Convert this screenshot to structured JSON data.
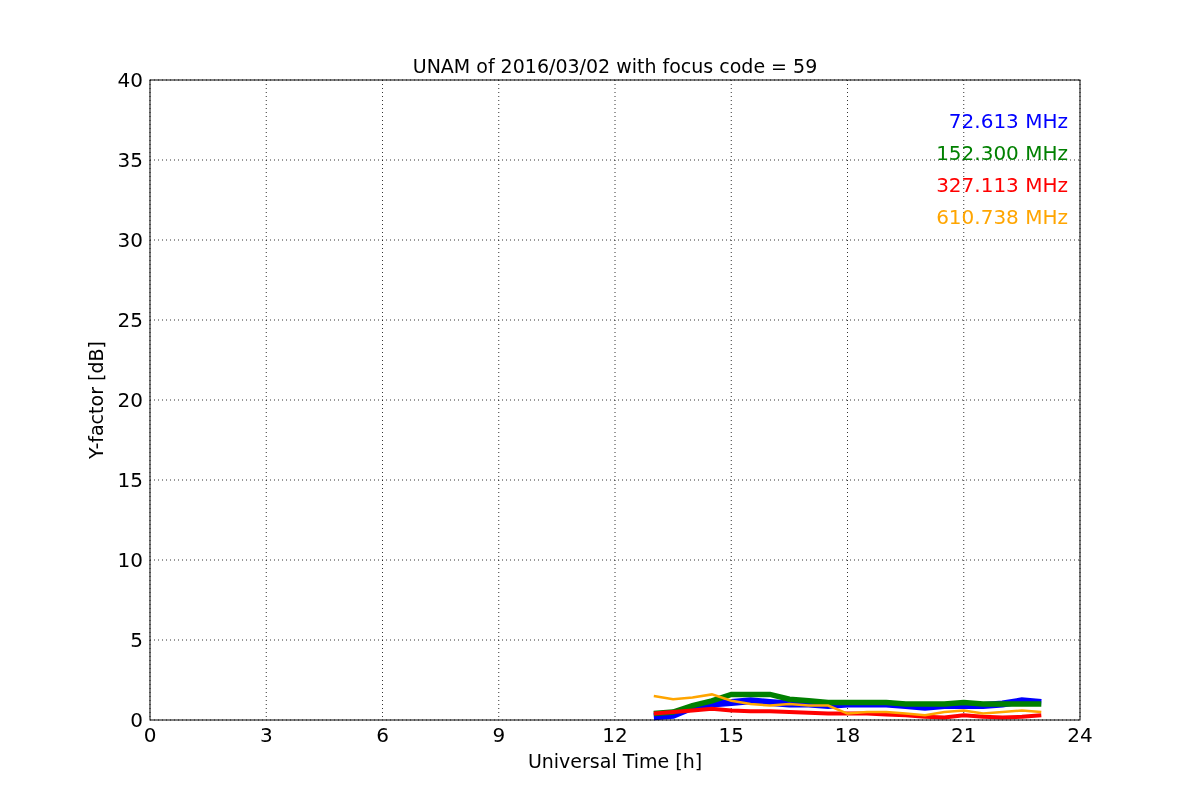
{
  "chart_data": {
    "type": "line",
    "title": "UNAM of 2016/03/02 with focus code = 59",
    "xlabel": "Universal Time [h]",
    "ylabel": "Y-factor [dB]",
    "x": [
      13,
      13.5,
      14,
      14.5,
      15,
      15.5,
      16,
      16.5,
      17,
      17.5,
      18,
      18.5,
      19,
      19.5,
      20,
      20.5,
      21,
      21.5,
      22,
      22.5,
      23
    ],
    "series": [
      {
        "name": "72.613 MHz",
        "color": "#0000ff",
        "values": [
          0.2,
          0.3,
          0.8,
          1.0,
          1.1,
          1.2,
          1.1,
          1.0,
          1.0,
          0.9,
          1.0,
          1.0,
          1.0,
          0.9,
          0.8,
          0.9,
          0.9,
          0.9,
          1.0,
          1.2,
          1.1
        ]
      },
      {
        "name": "152.300 MHz",
        "color": "#008000",
        "values": [
          0.4,
          0.5,
          0.9,
          1.2,
          1.6,
          1.6,
          1.6,
          1.3,
          1.2,
          1.1,
          1.1,
          1.1,
          1.1,
          1.0,
          1.0,
          1.0,
          1.1,
          1.0,
          1.0,
          1.0,
          1.0
        ]
      },
      {
        "name": "327.113 MHz",
        "color": "#ff0000",
        "values": [
          0.4,
          0.5,
          0.6,
          0.7,
          0.6,
          0.55,
          0.55,
          0.5,
          0.45,
          0.4,
          0.4,
          0.4,
          0.35,
          0.3,
          0.2,
          0.15,
          0.3,
          0.2,
          0.15,
          0.2,
          0.3
        ]
      },
      {
        "name": "610.738 MHz",
        "color": "#ffa500",
        "values": [
          1.5,
          1.3,
          1.4,
          1.6,
          1.2,
          1.0,
          0.9,
          1.0,
          0.9,
          0.9,
          0.4,
          0.5,
          0.5,
          0.4,
          0.3,
          0.5,
          0.6,
          0.4,
          0.5,
          0.6,
          0.5
        ]
      }
    ],
    "xlim": [
      0,
      24
    ],
    "ylim": [
      0,
      40
    ],
    "xticks": [
      0,
      3,
      6,
      9,
      12,
      15,
      18,
      21,
      24
    ],
    "yticks": [
      0,
      5,
      10,
      15,
      20,
      25,
      30,
      35,
      40
    ],
    "grid": true
  }
}
